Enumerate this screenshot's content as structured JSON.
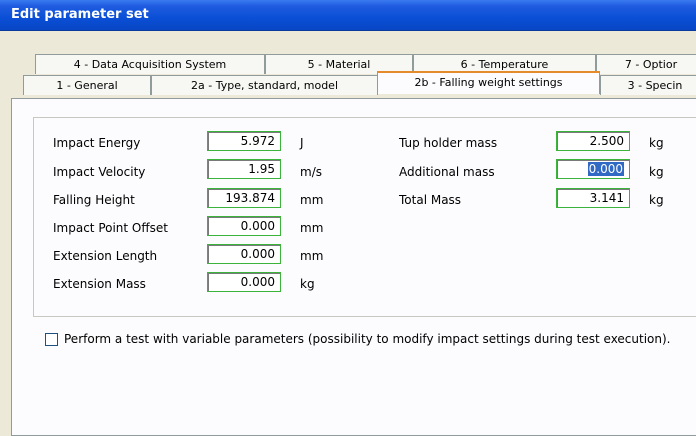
{
  "window": {
    "title": "Edit parameter set"
  },
  "tabs_back": [
    "4 - Data Acquisition System",
    "5 - Material",
    "6 - Temperature",
    "7 - Optior"
  ],
  "tabs_front": [
    "1 - General",
    "2a - Type, standard, model",
    "2b - Falling weight settings",
    "3 - Specin"
  ],
  "active_tab": "2b - Falling weight settings",
  "left_fields": [
    {
      "label": "Impact Energy",
      "value": "5.972",
      "unit": "J"
    },
    {
      "label": "Impact Velocity",
      "value": "1.95",
      "unit": "m/s"
    },
    {
      "label": "Falling Height",
      "value": "193.874",
      "unit": "mm"
    },
    {
      "label": "Impact Point Offset",
      "value": "0.000",
      "unit": "mm"
    },
    {
      "label": "Extension Length",
      "value": "0.000",
      "unit": "mm"
    },
    {
      "label": "Extension Mass",
      "value": "0.000",
      "unit": "kg"
    }
  ],
  "right_fields": [
    {
      "label": "Tup holder mass",
      "value": "2.500",
      "unit": "kg"
    },
    {
      "label": "Additional mass",
      "value": "0.000",
      "unit": "kg",
      "selected": true
    },
    {
      "label": "Total Mass",
      "value": "3.141",
      "unit": "kg"
    }
  ],
  "variable_params": {
    "checked": false,
    "label": "Perform a test with variable parameters (possibility to modify impact settings during test execution)."
  },
  "colors": {
    "title_bar": "#0a4fd6",
    "field_border": "#3cb43c",
    "active_tab_accent": "#e68b2c",
    "selection": "#316ac5"
  }
}
